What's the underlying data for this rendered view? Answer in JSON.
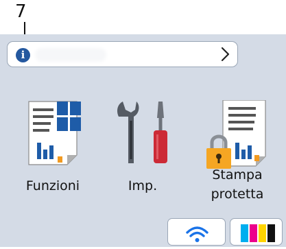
{
  "callout": {
    "number": "7"
  },
  "info_bar": {
    "info_icon": "info-icon",
    "chevron_icon": "chevron-right-icon",
    "message": ""
  },
  "tiles": [
    {
      "label": "Funzioni",
      "icon": "functions-icon"
    },
    {
      "label": "Imp.",
      "icon": "settings-tools-icon"
    },
    {
      "label_line1": "Stampa",
      "label_line2": "protetta",
      "icon": "secure-print-icon"
    }
  ],
  "status_buttons": [
    {
      "icon": "wifi-icon",
      "color": "#1a73e8"
    },
    {
      "icon": "toner-icon",
      "colors": [
        "#00aeef",
        "#ec008c",
        "#ffd400",
        "#111111"
      ]
    }
  ],
  "colors": {
    "screen_background": "#d4dbe6",
    "accent_blue": "#24589f",
    "tool_red": "#cc2a36"
  }
}
